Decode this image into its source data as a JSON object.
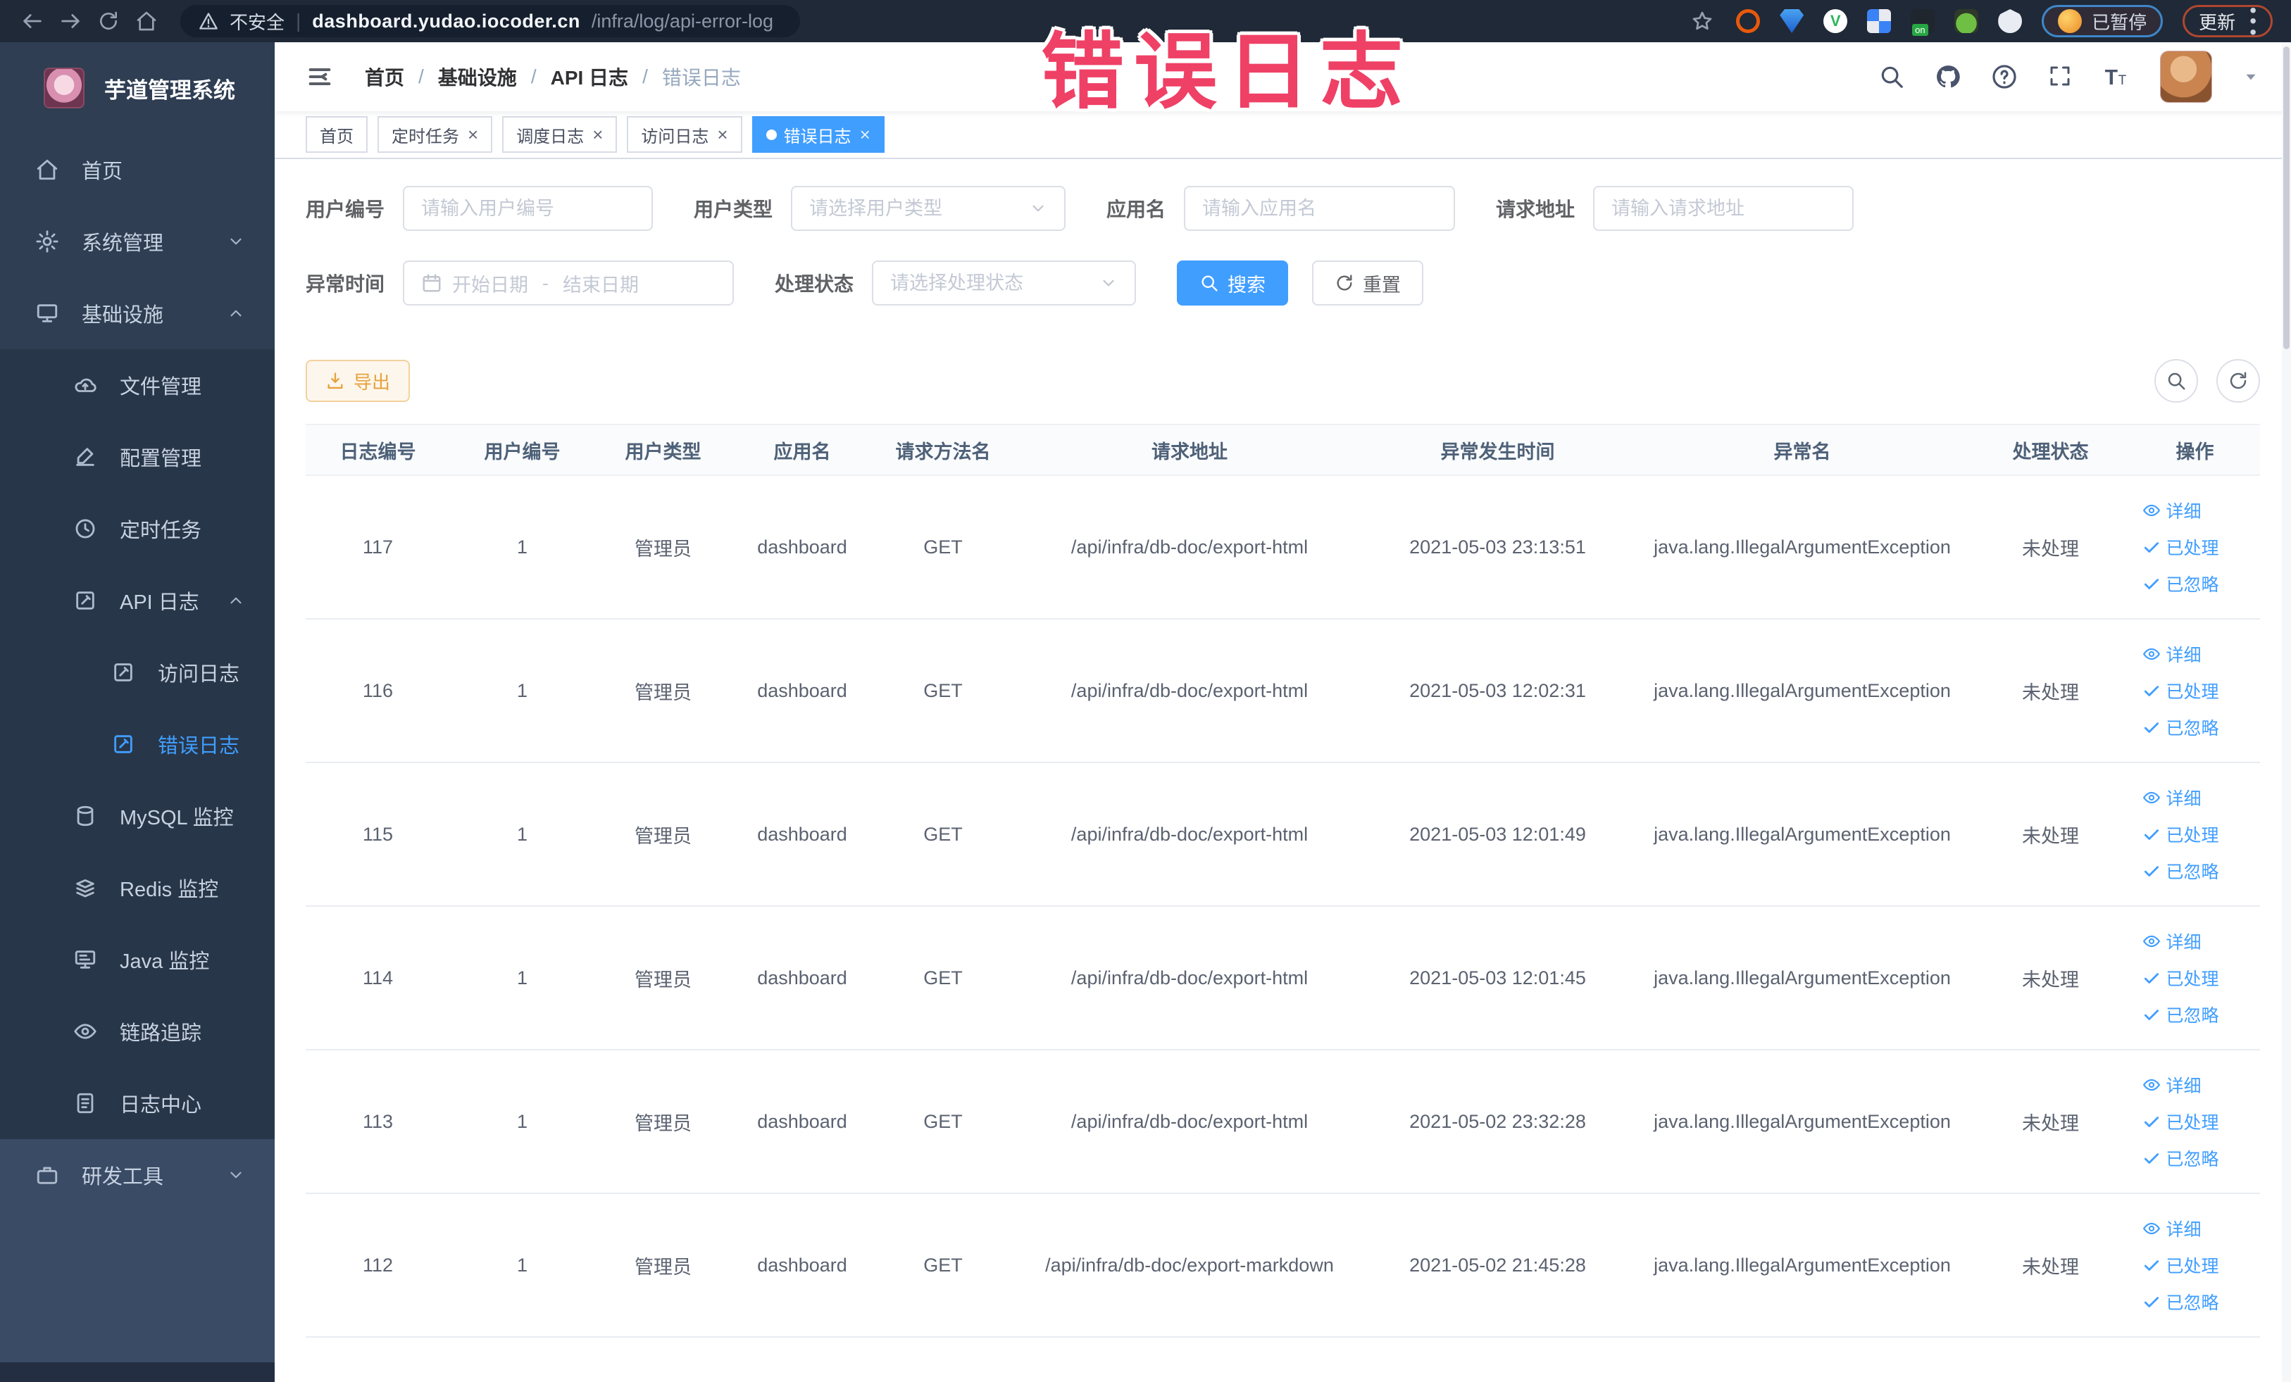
{
  "browser": {
    "security_label": "不安全",
    "url_domain": "dashboard.yudao.iocoder.cn",
    "url_path": "/infra/log/api-error-log",
    "paused_badge": "已暂停",
    "update_button": "更新"
  },
  "annotation": {
    "text": "错误日志"
  },
  "sidebar": {
    "logo_title": "芋道管理系统",
    "items": [
      {
        "name": "home",
        "label": "首页"
      },
      {
        "name": "system-management",
        "label": "系统管理"
      },
      {
        "name": "infrastructure",
        "label": "基础设施"
      },
      {
        "name": "file-management",
        "label": "文件管理"
      },
      {
        "name": "config-management",
        "label": "配置管理"
      },
      {
        "name": "scheduled-tasks",
        "label": "定时任务"
      },
      {
        "name": "api-logs",
        "label": "API 日志"
      },
      {
        "name": "access-log",
        "label": "访问日志"
      },
      {
        "name": "error-log",
        "label": "错误日志"
      },
      {
        "name": "mysql-monitor",
        "label": "MySQL 监控"
      },
      {
        "name": "redis-monitor",
        "label": "Redis 监控"
      },
      {
        "name": "java-monitor",
        "label": "Java 监控"
      },
      {
        "name": "link-tracing",
        "label": "链路追踪"
      },
      {
        "name": "log-center",
        "label": "日志中心"
      },
      {
        "name": "dev-tools",
        "label": "研发工具"
      }
    ]
  },
  "breadcrumb": {
    "items": [
      "首页",
      "基础设施",
      "API 日志",
      "错误日志"
    ]
  },
  "tabs": [
    {
      "name": "home",
      "label": "首页",
      "closable": false,
      "active": false
    },
    {
      "name": "scheduled-tasks",
      "label": "定时任务",
      "closable": true,
      "active": false
    },
    {
      "name": "schedule-log",
      "label": "调度日志",
      "closable": true,
      "active": false
    },
    {
      "name": "access-log",
      "label": "访问日志",
      "closable": true,
      "active": false
    },
    {
      "name": "error-log",
      "label": "错误日志",
      "closable": true,
      "active": true
    }
  ],
  "filters": {
    "user_id_label": "用户编号",
    "user_id_placeholder": "请输入用户编号",
    "user_type_label": "用户类型",
    "user_type_placeholder": "请选择用户类型",
    "app_name_label": "应用名",
    "app_name_placeholder": "请输入应用名",
    "request_url_label": "请求地址",
    "request_url_placeholder": "请输入请求地址",
    "exception_time_label": "异常时间",
    "start_date_placeholder": "开始日期",
    "date_separator": "-",
    "end_date_placeholder": "结束日期",
    "process_status_label": "处理状态",
    "process_status_placeholder": "请选择处理状态",
    "search_button": "搜索",
    "reset_button": "重置"
  },
  "toolbar": {
    "export_button": "导出"
  },
  "table": {
    "headers": [
      "日志编号",
      "用户编号",
      "用户类型",
      "应用名",
      "请求方法名",
      "请求地址",
      "异常发生时间",
      "异常名",
      "处理状态",
      "操作"
    ],
    "row_actions": [
      {
        "name": "detail",
        "label": "详细",
        "icon": "eye"
      },
      {
        "name": "processed",
        "label": "已处理",
        "icon": "check"
      },
      {
        "name": "ignored",
        "label": "已忽略",
        "icon": "check"
      }
    ],
    "rows": [
      {
        "log_id": "117",
        "user_id": "1",
        "user_type": "管理员",
        "app_name": "dashboard",
        "method": "GET",
        "url": "/api/infra/db-doc/export-html",
        "time": "2021-05-03 23:13:51",
        "exception": "java.lang.IllegalArgumentException",
        "status": "未处理"
      },
      {
        "log_id": "116",
        "user_id": "1",
        "user_type": "管理员",
        "app_name": "dashboard",
        "method": "GET",
        "url": "/api/infra/db-doc/export-html",
        "time": "2021-05-03 12:02:31",
        "exception": "java.lang.IllegalArgumentException",
        "status": "未处理"
      },
      {
        "log_id": "115",
        "user_id": "1",
        "user_type": "管理员",
        "app_name": "dashboard",
        "method": "GET",
        "url": "/api/infra/db-doc/export-html",
        "time": "2021-05-03 12:01:49",
        "exception": "java.lang.IllegalArgumentException",
        "status": "未处理"
      },
      {
        "log_id": "114",
        "user_id": "1",
        "user_type": "管理员",
        "app_name": "dashboard",
        "method": "GET",
        "url": "/api/infra/db-doc/export-html",
        "time": "2021-05-03 12:01:45",
        "exception": "java.lang.IllegalArgumentException",
        "status": "未处理"
      },
      {
        "log_id": "113",
        "user_id": "1",
        "user_type": "管理员",
        "app_name": "dashboard",
        "method": "GET",
        "url": "/api/infra/db-doc/export-html",
        "time": "2021-05-02 23:32:28",
        "exception": "java.lang.IllegalArgumentException",
        "status": "未处理"
      },
      {
        "log_id": "112",
        "user_id": "1",
        "user_type": "管理员",
        "app_name": "dashboard",
        "method": "GET",
        "url": "/api/infra/db-doc/export-markdown",
        "time": "2021-05-02 21:45:28",
        "exception": "java.lang.IllegalArgumentException",
        "status": "未处理"
      }
    ]
  },
  "colors": {
    "accent": "#409eff",
    "warning": "#e6a23c",
    "annotation": "#ef4066",
    "sidebar_bg": "#2f3e53"
  }
}
